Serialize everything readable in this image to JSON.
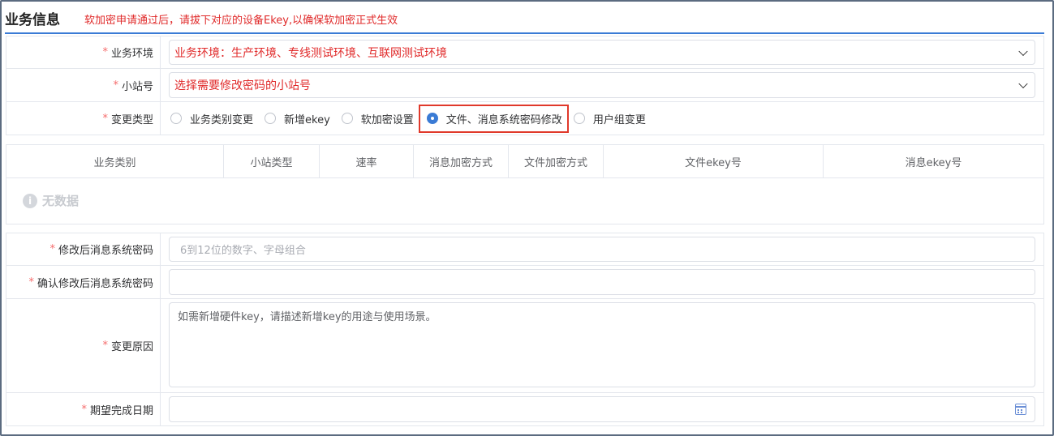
{
  "header": {
    "title": "业务信息",
    "notice": "软加密申请通过后，请拔下对应的设备Ekey,以确保软加密正式生效"
  },
  "form": {
    "required_mark": "*",
    "env": {
      "label": "业务环境",
      "value": "业务环境：生产环境、专线测试环境、互联网测试环境",
      "icon": "chevron-down-icon"
    },
    "station": {
      "label": "小站号",
      "value": "选择需要修改密码的小站号",
      "icon": "chevron-down-icon"
    },
    "change_type": {
      "label": "变更类型",
      "options": [
        "业务类别变更",
        "新增ekey",
        "软加密设置",
        "文件、消息系统密码修改",
        "用户组变更"
      ],
      "selected": "文件、消息系统密码修改"
    }
  },
  "table": {
    "columns": [
      "业务类别",
      "小站类型",
      "速率",
      "消息加密方式",
      "文件加密方式",
      "文件ekey号",
      "消息ekey号"
    ],
    "empty_text": "无数据",
    "empty_icon": "info-icon"
  },
  "form2": {
    "new_pwd": {
      "label": "修改后消息系统密码",
      "placeholder": "6到12位的数字、字母组合"
    },
    "confirm_pwd": {
      "label": "确认修改后消息系统密码",
      "placeholder": ""
    },
    "reason": {
      "label": "变更原因",
      "placeholder": "如需新增硬件key，请描述新增key的用途与使用场景。"
    },
    "date": {
      "label": "期望完成日期",
      "icon": "calendar-icon"
    }
  },
  "colors": {
    "accent": "#3a7bd5",
    "required": "#f56c6c",
    "notice": "#e02a2a",
    "highlight_border": "#e0392b"
  }
}
